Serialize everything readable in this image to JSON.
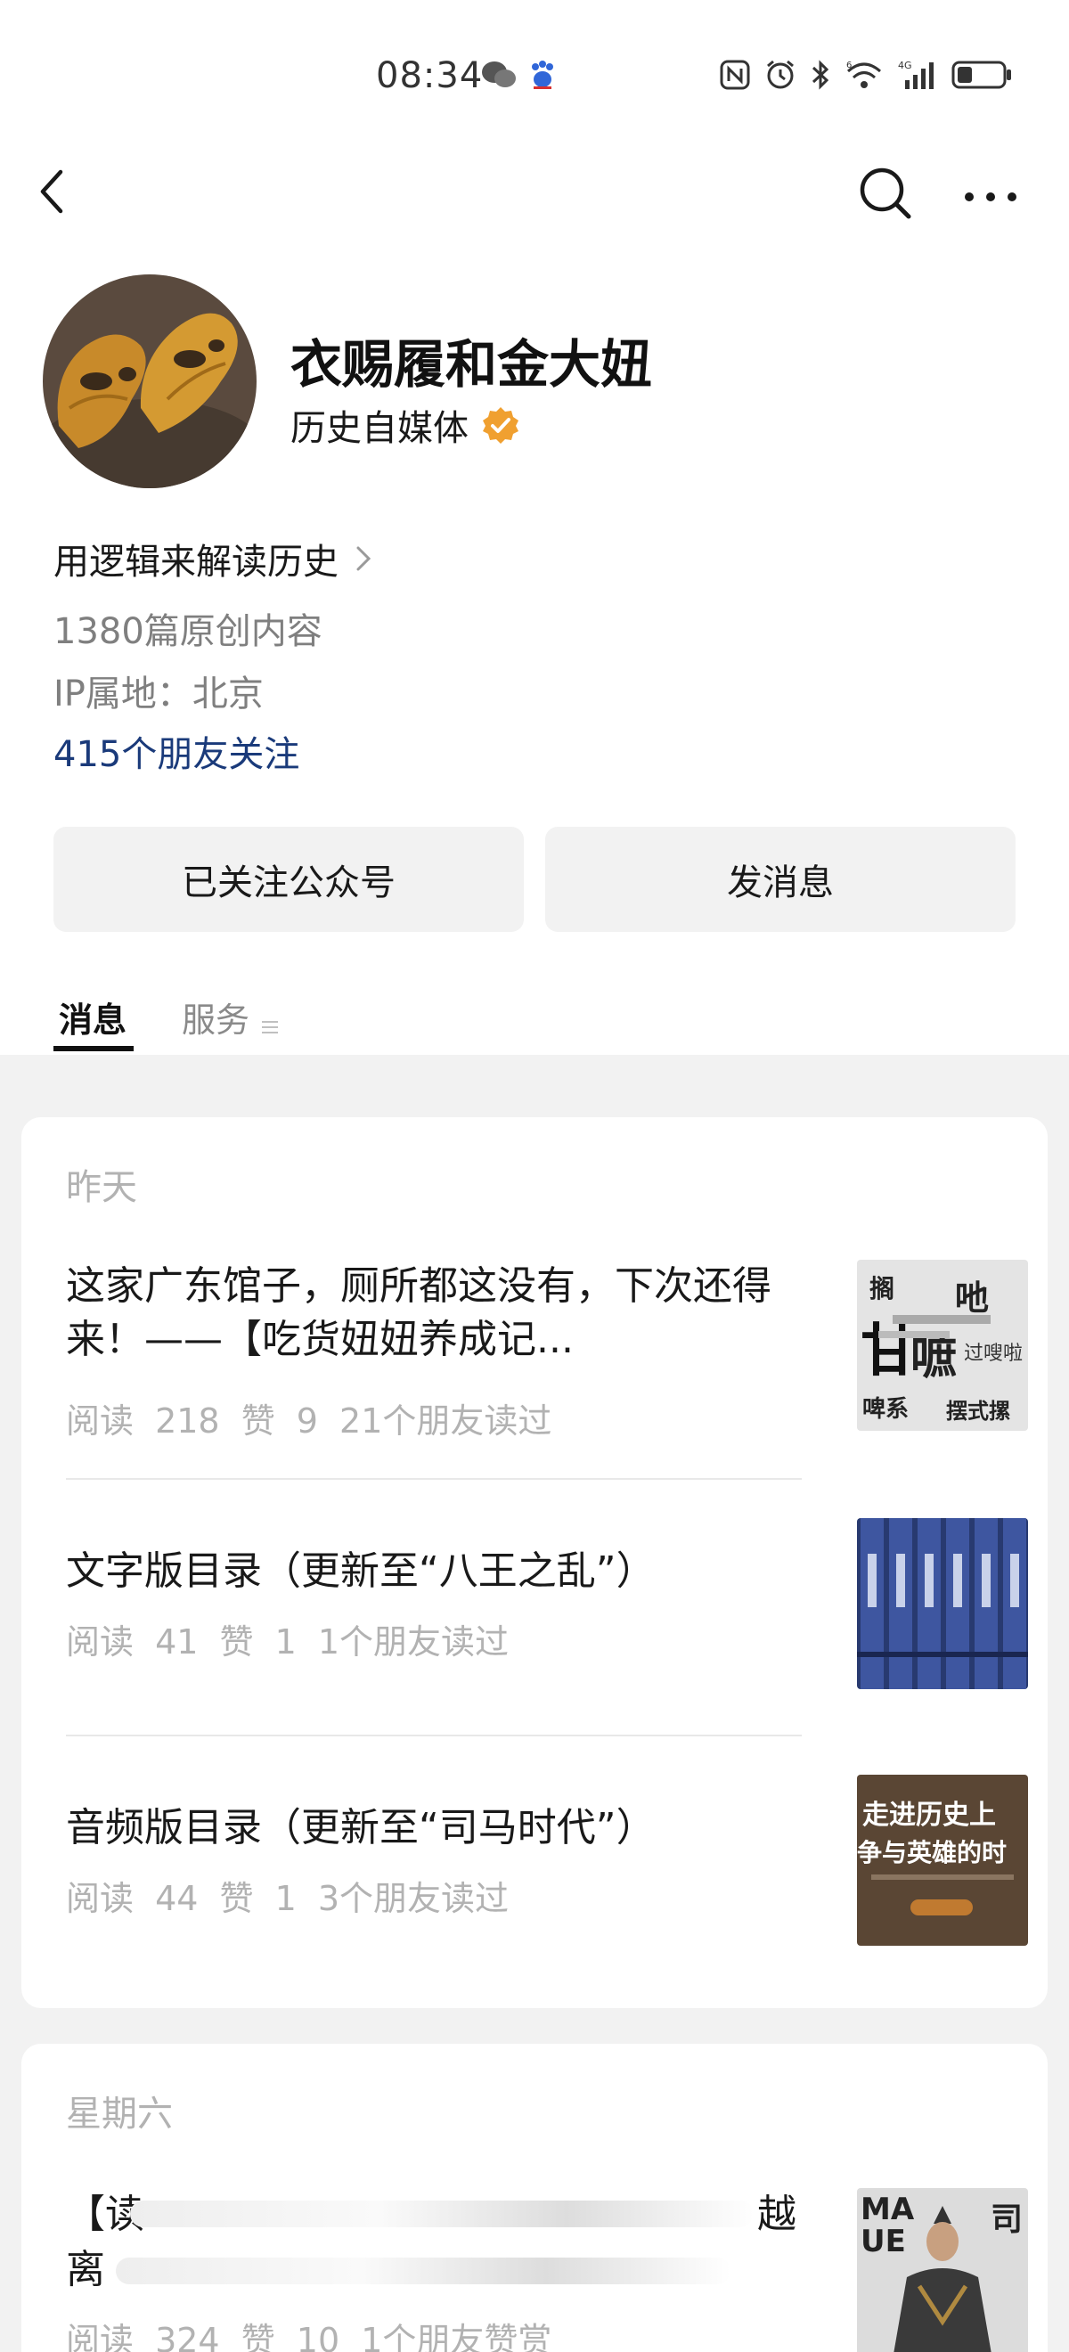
{
  "status_bar": {
    "time": "08:34",
    "left_icons": [
      "wechat-icon",
      "baidu-paw-icon"
    ],
    "right_icons": [
      "nfc-icon",
      "alarm-icon",
      "bluetooth-icon",
      "wifi-6-icon",
      "4g-signal-icon",
      "battery-icon"
    ]
  },
  "nav": {
    "back_icon": "back-chevron-icon",
    "search_icon": "search-icon",
    "more_icon": "more-dots-icon"
  },
  "profile": {
    "name": "衣赐履和金大妞",
    "type": "历史自媒体",
    "bio": "用逻辑来解读历史",
    "original_count": "1380篇原创内容",
    "ip_location": "IP属地：北京",
    "friends_following": "415个朋友关注",
    "verified_color": "#f0a030"
  },
  "actions": {
    "follow_label": "已关注公众号",
    "message_label": "发消息"
  },
  "tabs": {
    "messages": "消息",
    "services": "服务"
  },
  "feed": {
    "groups": [
      {
        "day": "昨天",
        "articles": [
          {
            "title": "这家广东馆子，厕所都这没有，下次还得来！——【吃货妞妞养成记...",
            "meta": "阅读 218  赞 9  21个朋友读过"
          },
          {
            "title": "文字版目录（更新至“八王之乱”）",
            "meta": "阅读 41  赞 1  1个朋友读过"
          },
          {
            "title": "音频版目录（更新至“司马时代”）",
            "meta": "阅读 44  赞 1  3个朋友读过"
          }
        ]
      },
      {
        "day": "星期六",
        "articles": [
          {
            "title_start": "【读",
            "title_end": "越",
            "title_line2_start": "离",
            "meta": "阅读 324  赞 10  1个朋友赞赏"
          }
        ]
      }
    ]
  },
  "thumbnails": {
    "t3_line1": "走进历史上",
    "t3_line2": "争与英雄的时",
    "t4_left": "MA",
    "t4_left2": "UE",
    "t4_right": "司"
  }
}
